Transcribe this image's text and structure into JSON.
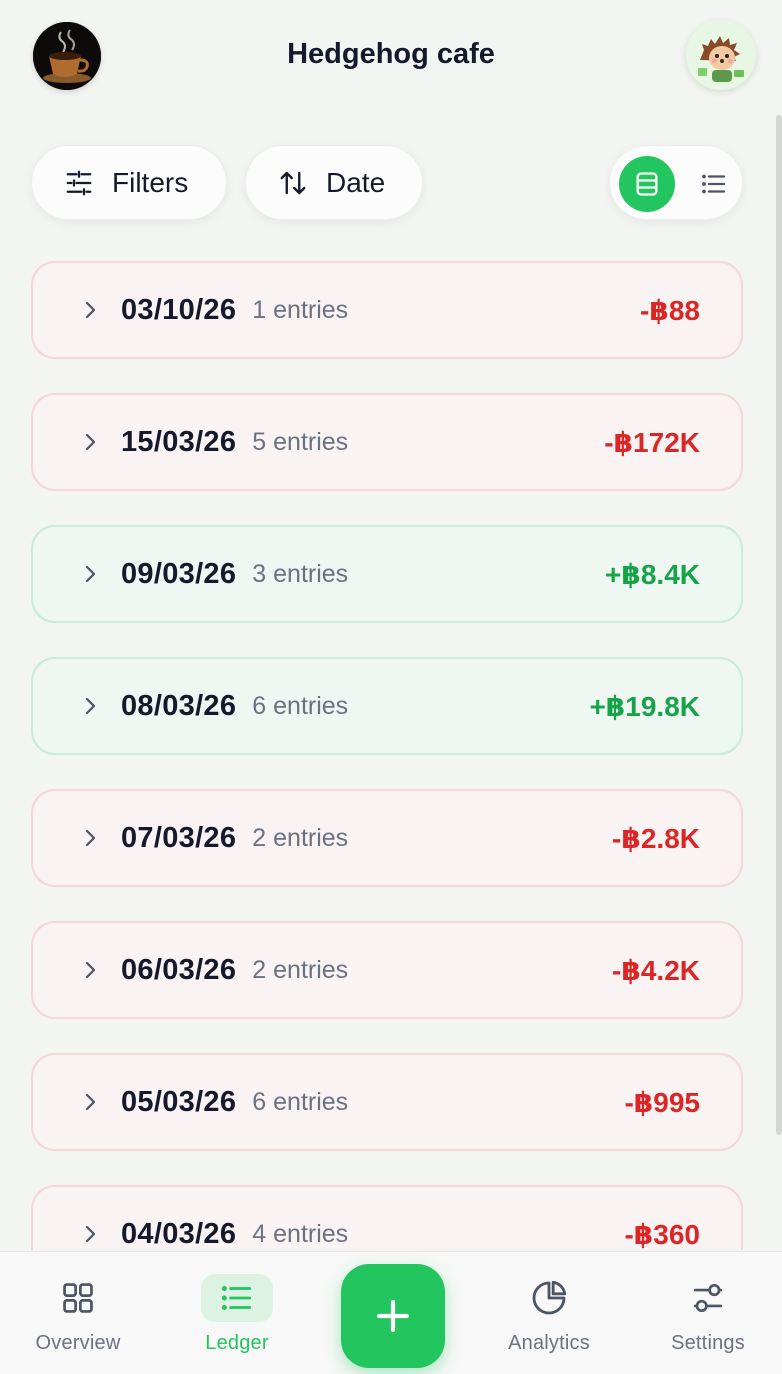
{
  "header": {
    "title": "Hedgehog cafe",
    "logo_icon": "coffee-cup-logo",
    "avatar_icon": "hedgehog-avatar"
  },
  "toolbar": {
    "filters_label": "Filters",
    "filters_icon": "sliders-icon",
    "sort_label": "Date",
    "sort_icon": "sort-arrows-icon",
    "view_modes": [
      {
        "name": "grouped",
        "icon": "grouped-view-icon",
        "active": true
      },
      {
        "name": "list",
        "icon": "list-view-icon",
        "active": false
      }
    ]
  },
  "days": [
    {
      "date": "03/10/26",
      "entries": "1 entries",
      "amount": "-฿88",
      "type": "negative"
    },
    {
      "date": "15/03/26",
      "entries": "5 entries",
      "amount": "-฿172K",
      "type": "negative"
    },
    {
      "date": "09/03/26",
      "entries": "3 entries",
      "amount": "+฿8.4K",
      "type": "positive"
    },
    {
      "date": "08/03/26",
      "entries": "6 entries",
      "amount": "+฿19.8K",
      "type": "positive"
    },
    {
      "date": "07/03/26",
      "entries": "2 entries",
      "amount": "-฿2.8K",
      "type": "negative"
    },
    {
      "date": "06/03/26",
      "entries": "2 entries",
      "amount": "-฿4.2K",
      "type": "negative"
    },
    {
      "date": "05/03/26",
      "entries": "6 entries",
      "amount": "-฿995",
      "type": "negative"
    },
    {
      "date": "04/03/26",
      "entries": "4 entries",
      "amount": "-฿360",
      "type": "negative"
    }
  ],
  "nav": {
    "items": [
      {
        "label": "Overview",
        "icon": "grid-icon",
        "active": false
      },
      {
        "label": "Ledger",
        "icon": "list-icon",
        "active": true
      },
      {
        "label": "Analytics",
        "icon": "pie-chart-icon",
        "active": false
      },
      {
        "label": "Settings",
        "icon": "toggles-icon",
        "active": false
      }
    ],
    "add_icon": "plus-icon"
  },
  "colors": {
    "accent": "#22c55e",
    "negative": "#dc2626",
    "positive": "#16a34a"
  }
}
